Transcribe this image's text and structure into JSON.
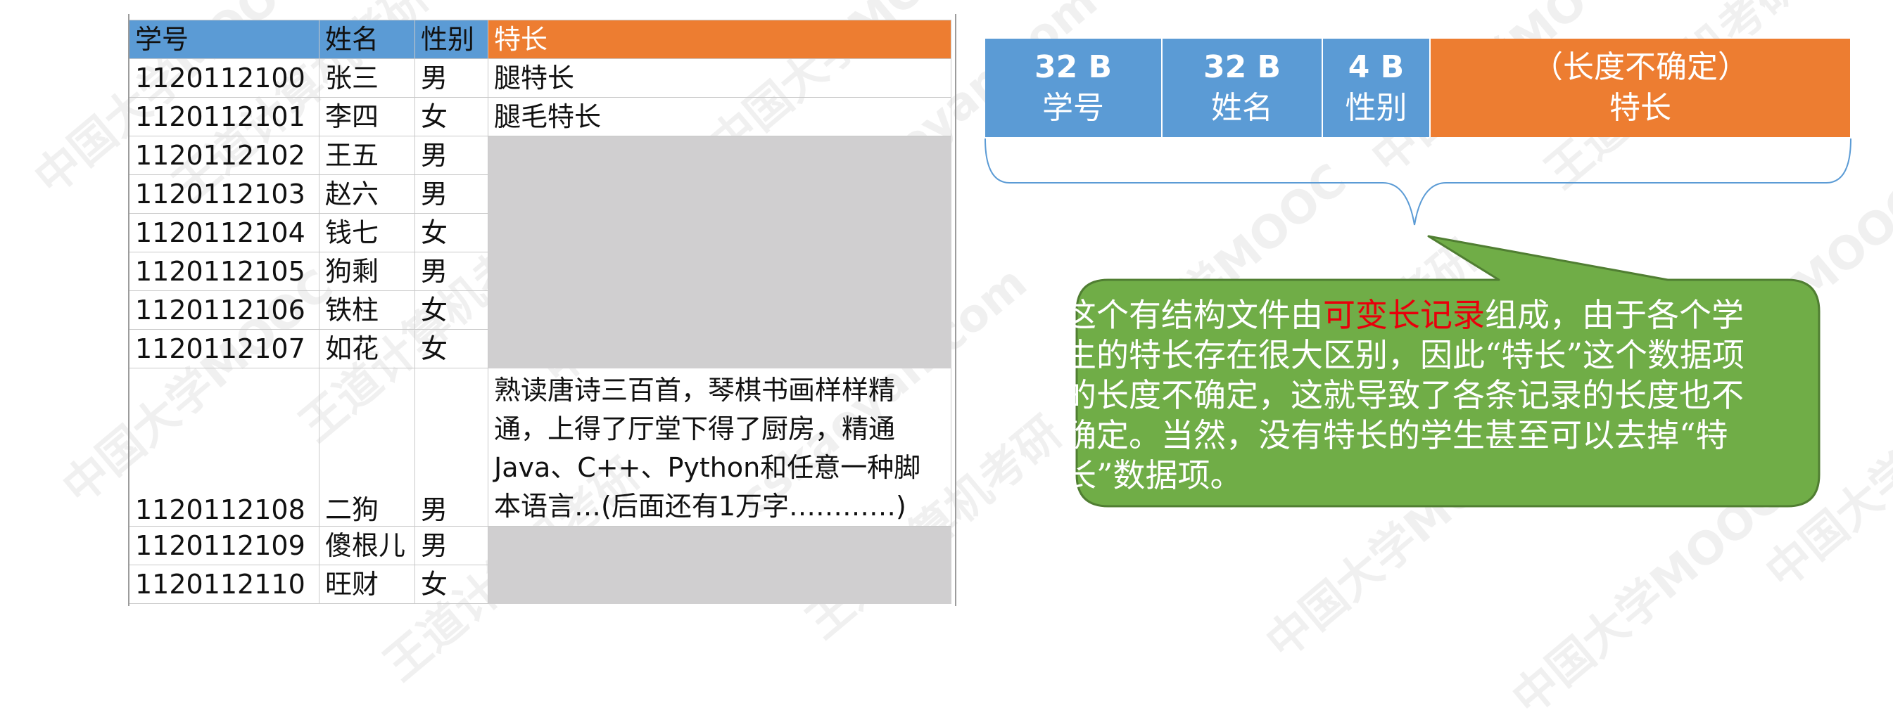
{
  "table": {
    "headers": [
      "学号",
      "姓名",
      "性别",
      "特长"
    ],
    "rows": [
      [
        "1120112100",
        "张三",
        "男",
        "腿特长"
      ],
      [
        "1120112101",
        "李四",
        "女",
        "腿毛特长"
      ],
      [
        "1120112102",
        "王五",
        "男",
        ""
      ],
      [
        "1120112103",
        "赵六",
        "男",
        ""
      ],
      [
        "1120112104",
        "钱七",
        "女",
        ""
      ],
      [
        "1120112105",
        "狗剩",
        "男",
        ""
      ],
      [
        "1120112106",
        "铁柱",
        "女",
        ""
      ],
      [
        "1120112107",
        "如花",
        "女",
        ""
      ],
      [
        "1120112108",
        "二狗",
        "男",
        "熟读唐诗三百首，琴棋书画样样精通，上得了厅堂下得了厨房，精通Java、C++、Python和任意一种脚本语言…(后面还有1万字…………)"
      ],
      [
        "1120112109",
        "傻根儿",
        "男",
        ""
      ],
      [
        "1120112110",
        "旺财",
        "女",
        ""
      ]
    ]
  },
  "record_layout": {
    "fields": [
      {
        "size": "32 B",
        "name": "学号"
      },
      {
        "size": "32 B",
        "name": "姓名"
      },
      {
        "size": "4 B",
        "name": "性别"
      },
      {
        "size": "（长度不确定）",
        "name": "特长"
      }
    ]
  },
  "callout": {
    "text_before": "这个有结构文件由",
    "highlight": "可变长记录",
    "text_after": "组成，由于各个学生的特长存在很大区别，因此“特长”这个数据项的长度不确定，这就导致了各条记录的长度也不确定。当然，没有特长的学生甚至可以去掉“特长”数据项。"
  },
  "colors": {
    "header_blue": "#5b9bd5",
    "header_orange": "#ed7d31",
    "empty_cell_grey": "#d0cfd0",
    "callout_green": "#70ad47",
    "highlight_red": "#e8000b"
  },
  "watermark": {
    "texts": [
      "中国大学MOOC",
      "王道计算机考研",
      "cskaoyan.com"
    ]
  }
}
